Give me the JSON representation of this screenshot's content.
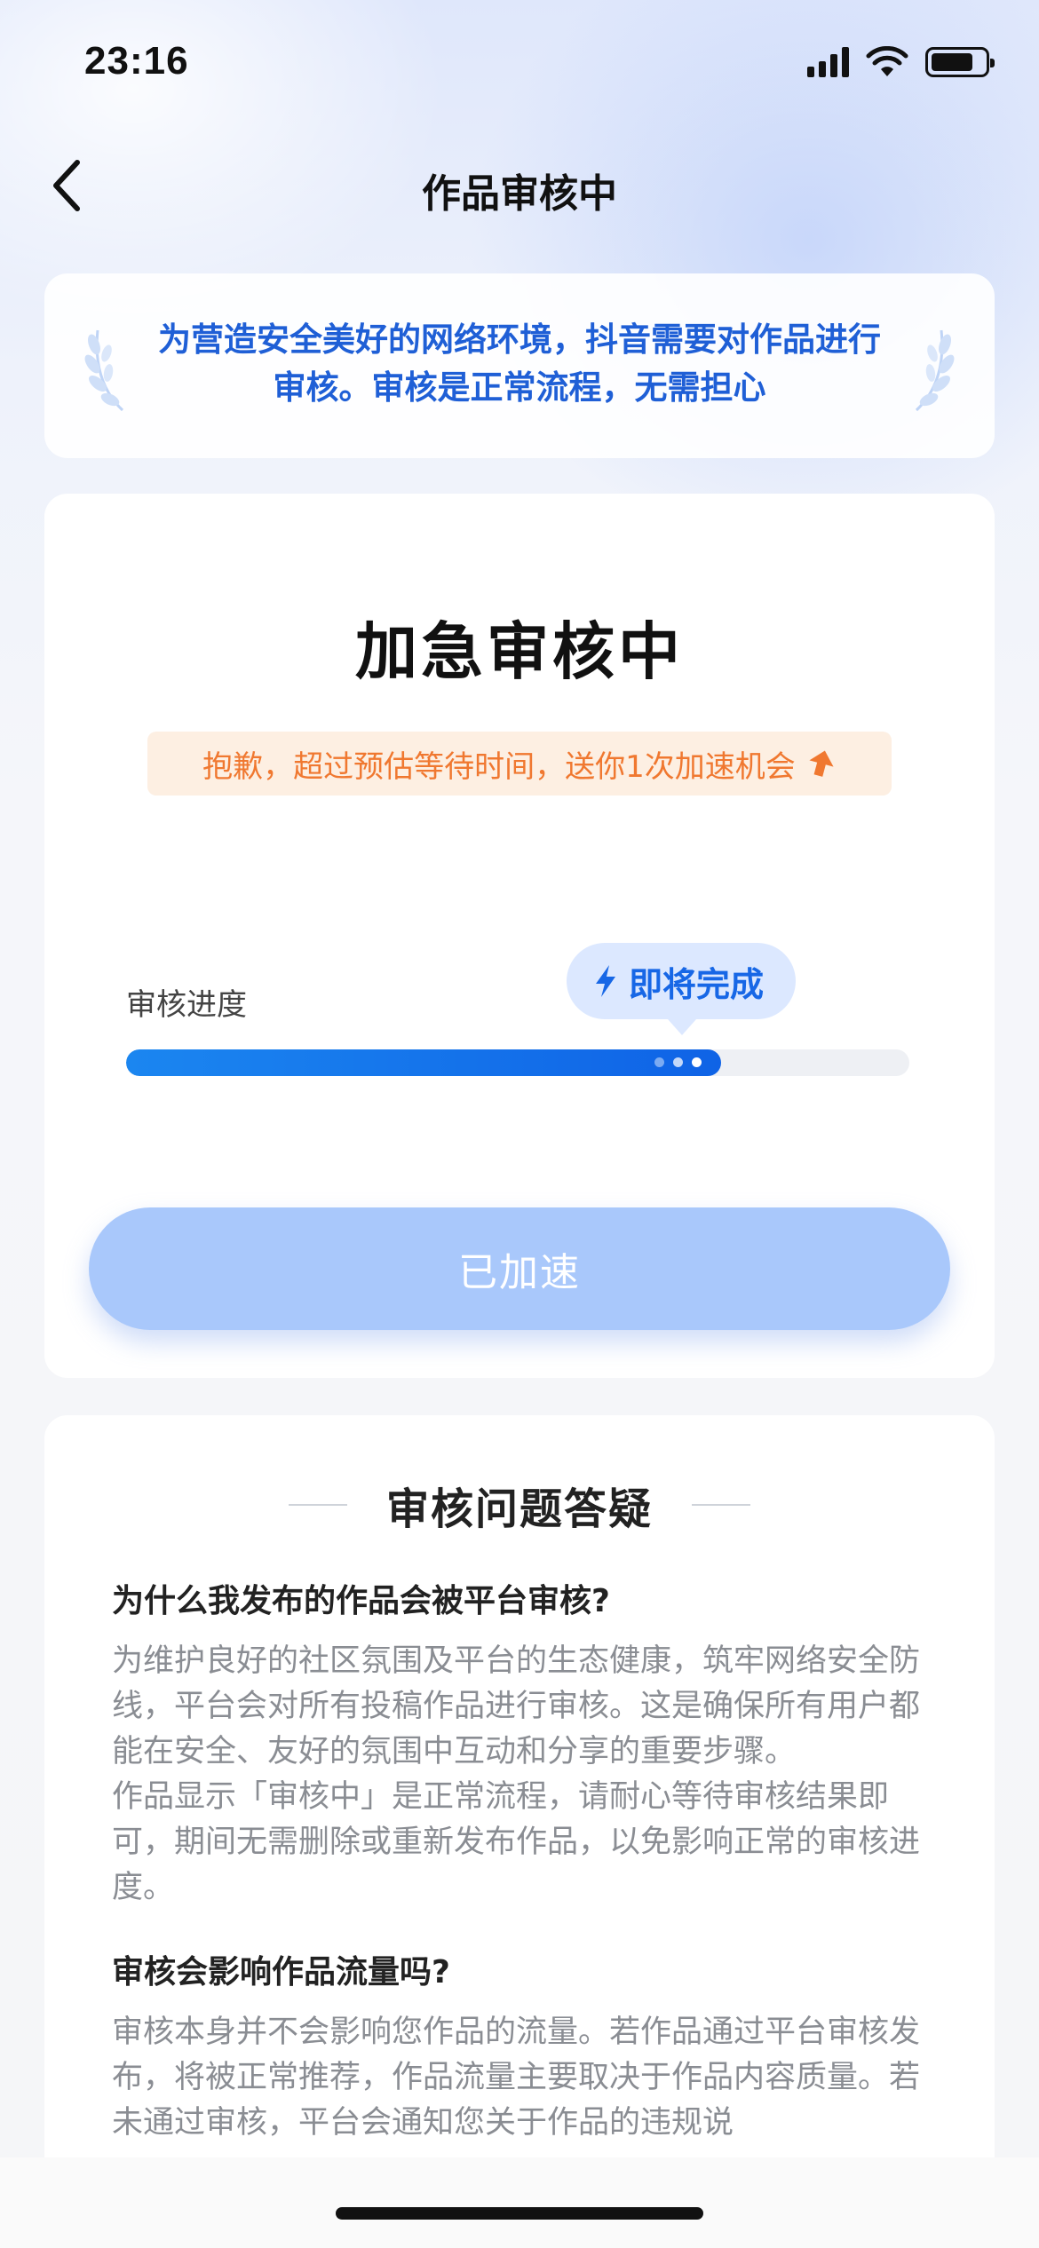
{
  "status_bar": {
    "time": "23:16",
    "battery_level_percent": 80
  },
  "nav": {
    "title": "作品审核中",
    "back_icon": "chevron-left-icon"
  },
  "notice": {
    "text": "为营造安全美好的网络环境，抖音需要对作品进行审核。审核是正常流程，无需担心"
  },
  "review": {
    "title": "加急审核中",
    "apology": "抱歉，超过预估等待时间，送你1次加速机会",
    "progress_label": "审核进度",
    "tooltip": "即将完成",
    "progress_fraction": 0.76,
    "button_label": "已加速",
    "colors": {
      "accent": "#1767e6",
      "apology_text": "#f07830",
      "button_bg": "#a9c8fb"
    }
  },
  "faq": {
    "title": "审核问题答疑",
    "items": [
      {
        "question": "为什么我发布的作品会被平台审核?",
        "answer_1": "为维护良好的社区氛围及平台的生态健康，筑牢网络安全防线，平台会对所有投稿作品进行审核。这是确保所有用户都能在安全、友好的氛围中互动和分享的重要步骤。",
        "answer_2": "作品显示「审核中」是正常流程，请耐心等待审核结果即可，期间无需删除或重新发布作品，以免影响正常的审核进度。"
      },
      {
        "question": "审核会影响作品流量吗?",
        "answer_1": "审核本身并不会影响您作品的流量。若作品通过平台审核发布，将被正常推荐，作品流量主要取决于作品内容质量。若未通过审核，平台会通知您关于作品的违规说"
      }
    ]
  }
}
